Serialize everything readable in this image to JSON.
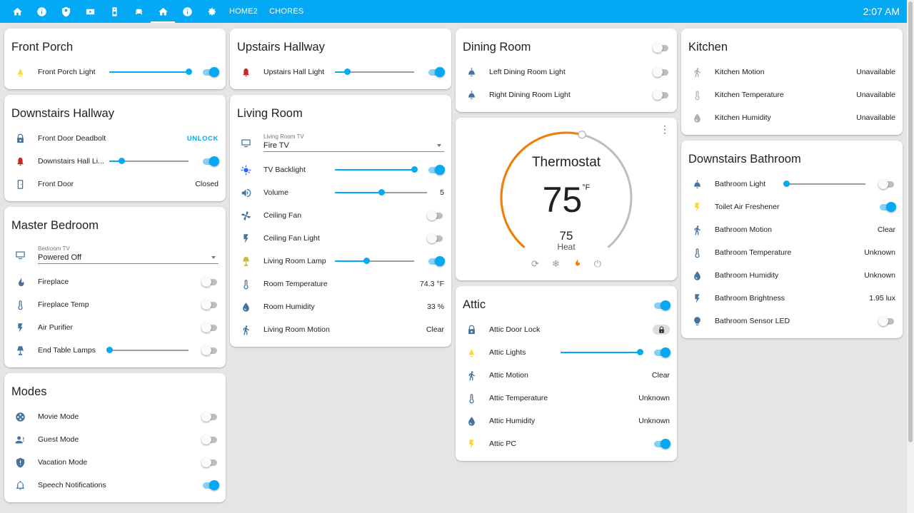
{
  "topbar": {
    "tabs": [
      {
        "icon": "home-icon"
      },
      {
        "icon": "info-icon"
      },
      {
        "icon": "security-icon"
      },
      {
        "icon": "youtube-icon"
      },
      {
        "icon": "speaker-icon"
      },
      {
        "icon": "car-icon"
      },
      {
        "icon": "home-active-icon",
        "active": true
      },
      {
        "icon": "info-icon"
      },
      {
        "icon": "settings-icon"
      }
    ],
    "text_tabs": [
      "HOME2",
      "CHORES"
    ],
    "clock": "2:07 AM"
  },
  "cards": {
    "front_porch": {
      "title": "Front Porch",
      "rows": [
        {
          "label": "Front Porch Light",
          "icon": "light-icon",
          "slider": 1.0,
          "on": true
        }
      ]
    },
    "downstairs_hallway": {
      "title": "Downstairs Hallway",
      "rows": [
        {
          "label": "Front Door Deadbolt",
          "icon": "lock-icon",
          "button": "UNLOCK"
        },
        {
          "label": "Downstairs Hall Li...",
          "icon": "bell-light-icon",
          "slider": 0.15,
          "on": true
        },
        {
          "label": "Front Door",
          "icon": "door-icon",
          "value": "Closed"
        }
      ]
    },
    "master_bedroom": {
      "title": "Master Bedroom",
      "select": {
        "label": "Bedroom TV",
        "value": "Powered Off"
      },
      "rows": [
        {
          "label": "Fireplace",
          "icon": "fire-icon",
          "on": false
        },
        {
          "label": "Fireplace Temp",
          "icon": "thermometer-icon",
          "on": false
        },
        {
          "label": "Air Purifier",
          "icon": "flash-icon",
          "on": false
        },
        {
          "label": "End Table Lamps",
          "icon": "lamp-icon",
          "slider": 0.0,
          "on": false
        }
      ]
    },
    "modes": {
      "title": "Modes",
      "rows": [
        {
          "label": "Movie Mode",
          "icon": "film-icon",
          "on": false
        },
        {
          "label": "Guest Mode",
          "icon": "guest-icon",
          "on": false
        },
        {
          "label": "Vacation Mode",
          "icon": "shield-icon",
          "on": false
        },
        {
          "label": "Speech Notifications",
          "icon": "bell-icon",
          "on": true
        }
      ]
    },
    "upstairs_hallway": {
      "title": "Upstairs Hallway",
      "rows": [
        {
          "label": "Upstairs Hall Light",
          "icon": "bell-light-icon",
          "slider": 0.15,
          "on": true
        }
      ]
    },
    "living_room": {
      "title": "Living Room",
      "select": {
        "label": "Living Room TV",
        "value": "Fire TV"
      },
      "rows": [
        {
          "label": "TV Backlight",
          "icon": "backlight-icon",
          "slider": 1.0,
          "on": true
        },
        {
          "label": "Volume",
          "icon": "volume-icon",
          "slider": 0.5,
          "value": "5"
        },
        {
          "label": "Ceiling Fan",
          "icon": "fan-icon",
          "on": false
        },
        {
          "label": "Ceiling Fan Light",
          "icon": "flash-icon",
          "on": false
        },
        {
          "label": "Living Room Lamp",
          "icon": "lamp-icon",
          "slider": 0.4,
          "on": true
        },
        {
          "label": "Room Temperature",
          "icon": "thermometer-icon",
          "value": "74.3 °F"
        },
        {
          "label": "Room Humidity",
          "icon": "water-icon",
          "value": "33 %"
        },
        {
          "label": "Living Room Motion",
          "icon": "walk-icon",
          "value": "Clear"
        }
      ]
    },
    "dining_room": {
      "title": "Dining Room",
      "header_on": false,
      "rows": [
        {
          "label": "Left Dining Room Light",
          "icon": "ceiling-light-icon",
          "on": false
        },
        {
          "label": "Right Dining Room Light",
          "icon": "ceiling-light-icon",
          "on": false
        }
      ]
    },
    "thermostat": {
      "name": "Thermostat",
      "current": "75",
      "unit": "°F",
      "target": "75",
      "mode": "Heat",
      "heat_level": 0.55
    },
    "attic": {
      "title": "Attic",
      "header_on": true,
      "rows": [
        {
          "label": "Attic Door Lock",
          "icon": "lock-icon",
          "lock": true
        },
        {
          "label": "Attic Lights",
          "icon": "light-icon",
          "slider": 1.0,
          "on": true
        },
        {
          "label": "Attic Motion",
          "icon": "walk-icon",
          "value": "Clear"
        },
        {
          "label": "Attic Temperature",
          "icon": "thermometer-icon",
          "value": "Unknown"
        },
        {
          "label": "Attic Humidity",
          "icon": "water-icon",
          "value": "Unknown"
        },
        {
          "label": "Attic PC",
          "icon": "flash-icon",
          "on": true
        }
      ]
    },
    "kitchen": {
      "title": "Kitchen",
      "rows": [
        {
          "label": "Kitchen Motion",
          "icon": "walk-icon",
          "value": "Unavailable",
          "dim": true
        },
        {
          "label": "Kitchen Temperature",
          "icon": "thermometer-icon",
          "value": "Unavailable",
          "dim": true
        },
        {
          "label": "Kitchen Humidity",
          "icon": "water-icon",
          "value": "Unavailable",
          "dim": true
        }
      ]
    },
    "downstairs_bathroom": {
      "title": "Downstairs Bathroom",
      "rows": [
        {
          "label": "Bathroom Light",
          "icon": "ceiling-light-icon",
          "slider": 0.0,
          "on": false
        },
        {
          "label": "Toilet Air Freshener",
          "icon": "flash-icon",
          "on": true
        },
        {
          "label": "Bathroom Motion",
          "icon": "walk-icon",
          "value": "Clear"
        },
        {
          "label": "Bathroom Temperature",
          "icon": "thermometer-icon",
          "value": "Unknown"
        },
        {
          "label": "Bathroom Humidity",
          "icon": "water-icon",
          "value": "Unknown"
        },
        {
          "label": "Bathroom Brightness",
          "icon": "flash-icon",
          "value": "1.95 lux"
        },
        {
          "label": "Bathroom Sensor LED",
          "icon": "bulb-icon",
          "on": false
        }
      ]
    }
  }
}
